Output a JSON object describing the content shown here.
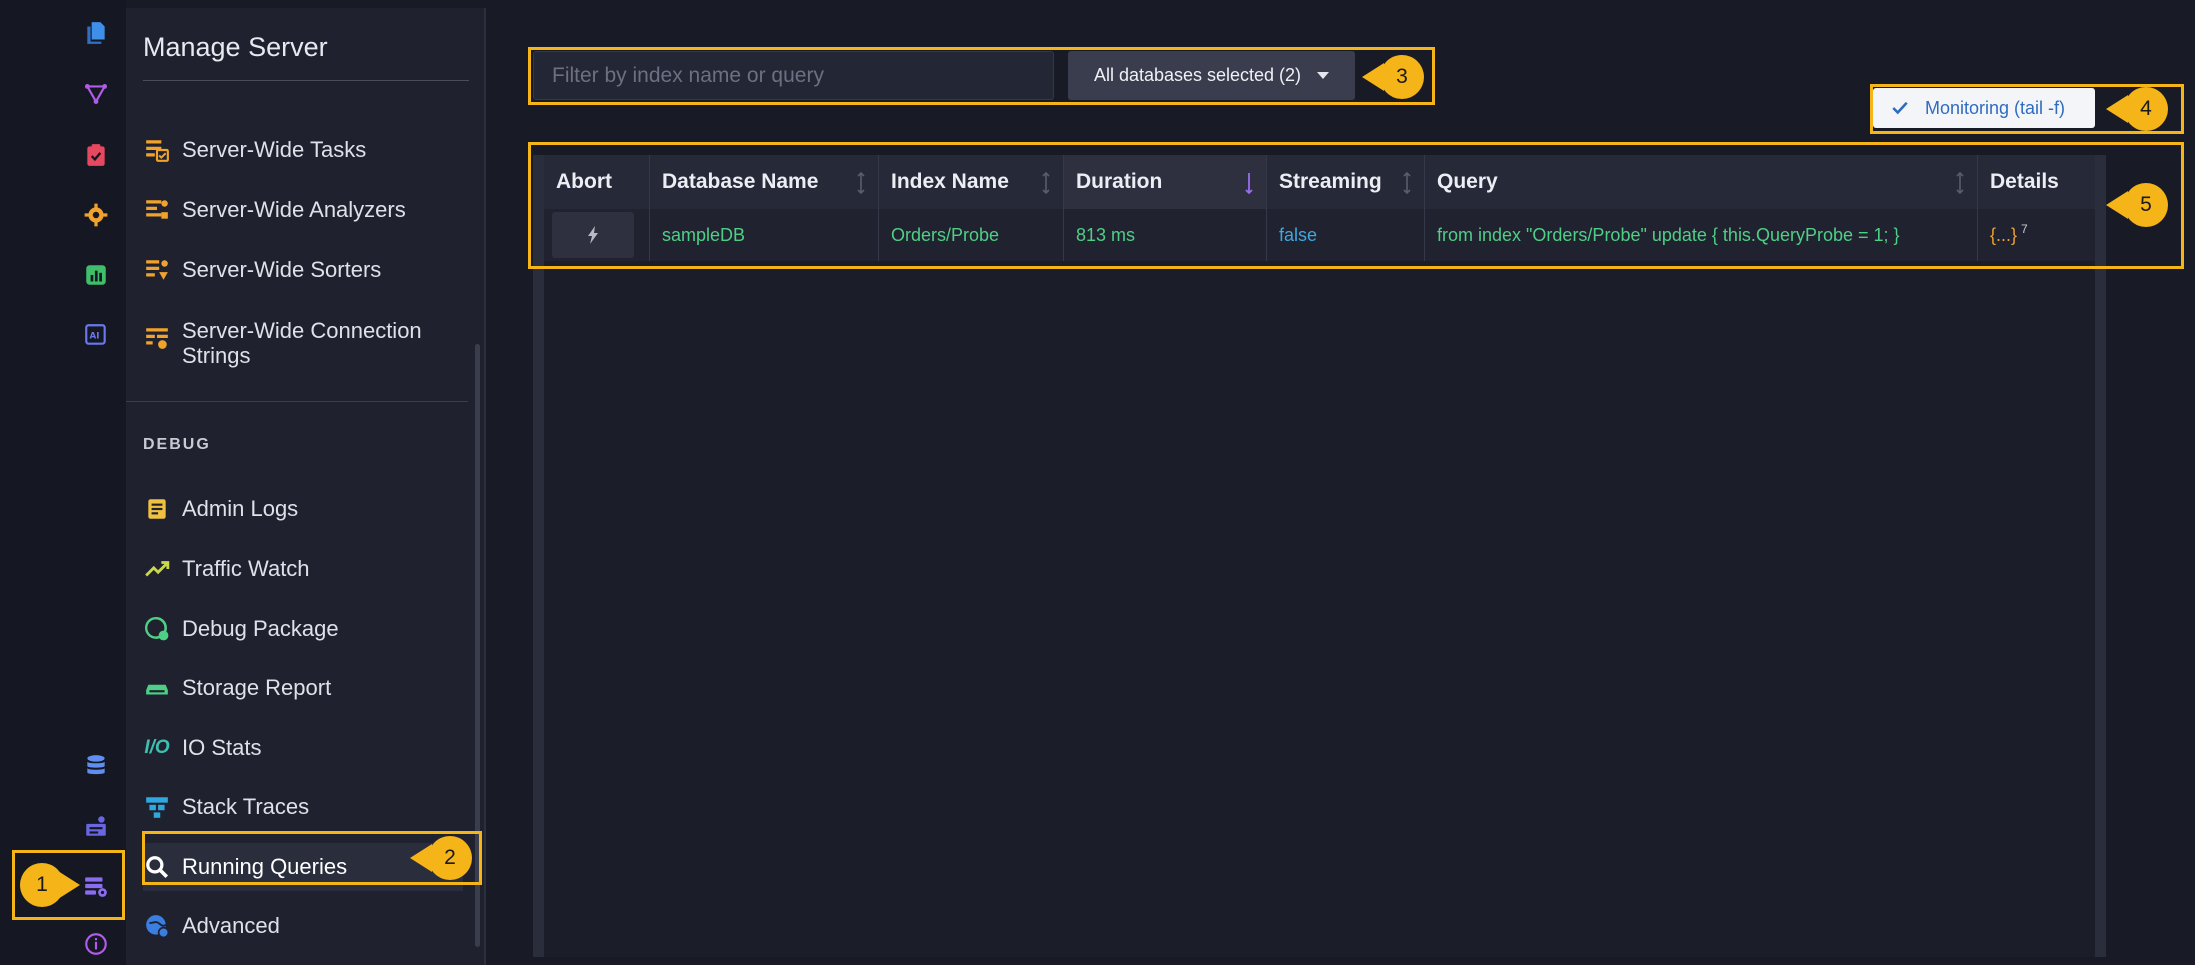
{
  "menu": {
    "title": "Manage Server",
    "items": [
      {
        "label": "Server-Wide Tasks",
        "icon": "server-tasks-icon"
      },
      {
        "label": "Server-Wide Analyzers",
        "icon": "analyzers-icon"
      },
      {
        "label": "Server-Wide Sorters",
        "icon": "sorters-icon"
      },
      {
        "label": "Server-Wide Connection Strings",
        "icon": "connection-strings-icon"
      }
    ],
    "debug_label": "DEBUG",
    "debug_items": [
      {
        "label": "Admin Logs",
        "icon": "admin-logs-icon"
      },
      {
        "label": "Traffic Watch",
        "icon": "traffic-watch-icon"
      },
      {
        "label": "Debug Package",
        "icon": "debug-package-icon"
      },
      {
        "label": "Storage Report",
        "icon": "storage-report-icon"
      },
      {
        "label": "IO Stats",
        "icon": "io-stats-icon",
        "icon_text": "I/O"
      },
      {
        "label": "Stack Traces",
        "icon": "stack-traces-icon"
      },
      {
        "label": "Running Queries",
        "icon": "running-queries-icon",
        "active": true
      },
      {
        "label": "Advanced",
        "icon": "advanced-icon"
      }
    ]
  },
  "toolbar": {
    "filter_placeholder": "Filter by index name or query",
    "db_select_label": "All databases selected (2)",
    "monitoring_label": "Monitoring (tail -f)"
  },
  "table": {
    "columns": [
      "Abort",
      "Database Name",
      "Index Name",
      "Duration",
      "Streaming",
      "Query",
      "Details"
    ],
    "sorted_column": "Duration",
    "rows": [
      {
        "database": "sampleDB",
        "index": "Orders/Probe",
        "duration": "813 ms",
        "streaming": "false",
        "query": "from index \"Orders/Probe\" update { this.QueryProbe = 1; }",
        "details": "{...}",
        "details_count": "7"
      }
    ]
  },
  "callouts": [
    "1",
    "2",
    "3",
    "4",
    "5"
  ],
  "colors": {
    "accent": "#f5b417",
    "green": "#4fcf86",
    "blue": "#3ea8e0",
    "orange": "#f0a22c",
    "background": "#181a25"
  }
}
